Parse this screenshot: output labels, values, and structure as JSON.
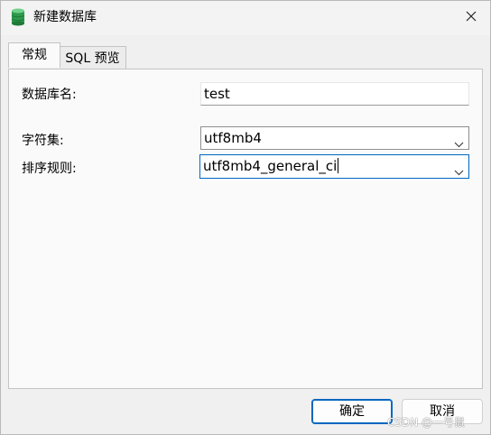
{
  "window": {
    "title": "新建数据库",
    "icon": "database-icon",
    "close_icon": "close-icon"
  },
  "tabs": [
    {
      "label": "常规",
      "active": true
    },
    {
      "label": "SQL 预览",
      "active": false
    }
  ],
  "form": {
    "name_label": "数据库名:",
    "name_value": "test",
    "charset_label": "字符集:",
    "charset_value": "utf8mb4",
    "collation_label": "排序规则:",
    "collation_value": "utf8mb4_general_ci"
  },
  "buttons": {
    "ok_label": "确定",
    "cancel_label": "取消"
  },
  "watermark": "CSDN @一号鼠",
  "colors": {
    "accent": "#0067c0",
    "window_bg": "#f0f0f0",
    "panel_bg": "#fafafa",
    "db_icon": "#3aa655"
  }
}
